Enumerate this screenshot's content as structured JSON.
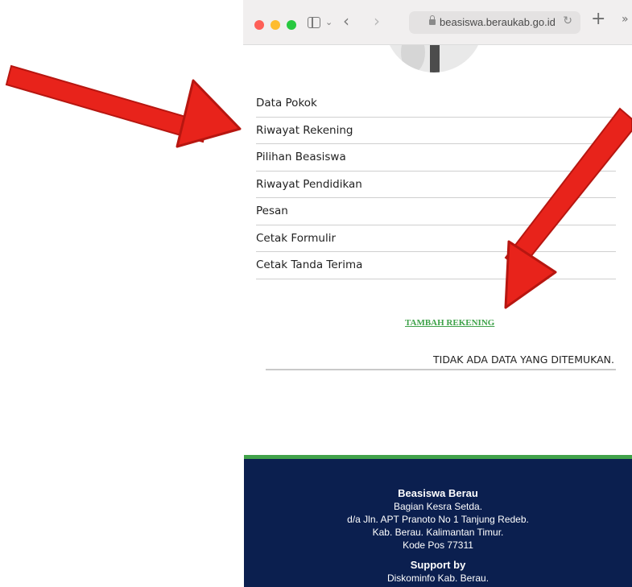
{
  "browser": {
    "url": "beasiswa.beraukab.go.id",
    "nav_back": "‹",
    "nav_forward": "›",
    "new_tab": "+",
    "more": "»",
    "reload": "↻",
    "sidebar_chevron": "⌄"
  },
  "menu": {
    "items": [
      "Data Pokok",
      "Riwayat Rekening",
      "Pilihan Beasiswa",
      "Riwayat Pendidikan",
      "Pesan",
      "Cetak Formulir",
      "Cetak Tanda Terima"
    ]
  },
  "content": {
    "add_account_link": "TAMBAH REKENING",
    "empty_message": "TIDAK ADA DATA YANG DITEMUKAN."
  },
  "footer": {
    "title": "Beasiswa Berau",
    "lines": [
      "Bagian Kesra Setda.",
      "d/a Jln. APT Pranoto No 1 Tanjung Redeb.",
      "Kab. Berau. Kalimantan Timur.",
      "Kode Pos 77311"
    ],
    "support_title": "Support by",
    "support_line": "Diskominfo Kab. Berau."
  },
  "colors": {
    "arrow": "#e8231b",
    "link_green": "#3fa24a",
    "footer_bg": "#0b1f4f",
    "footer_accent": "#41a24a"
  }
}
